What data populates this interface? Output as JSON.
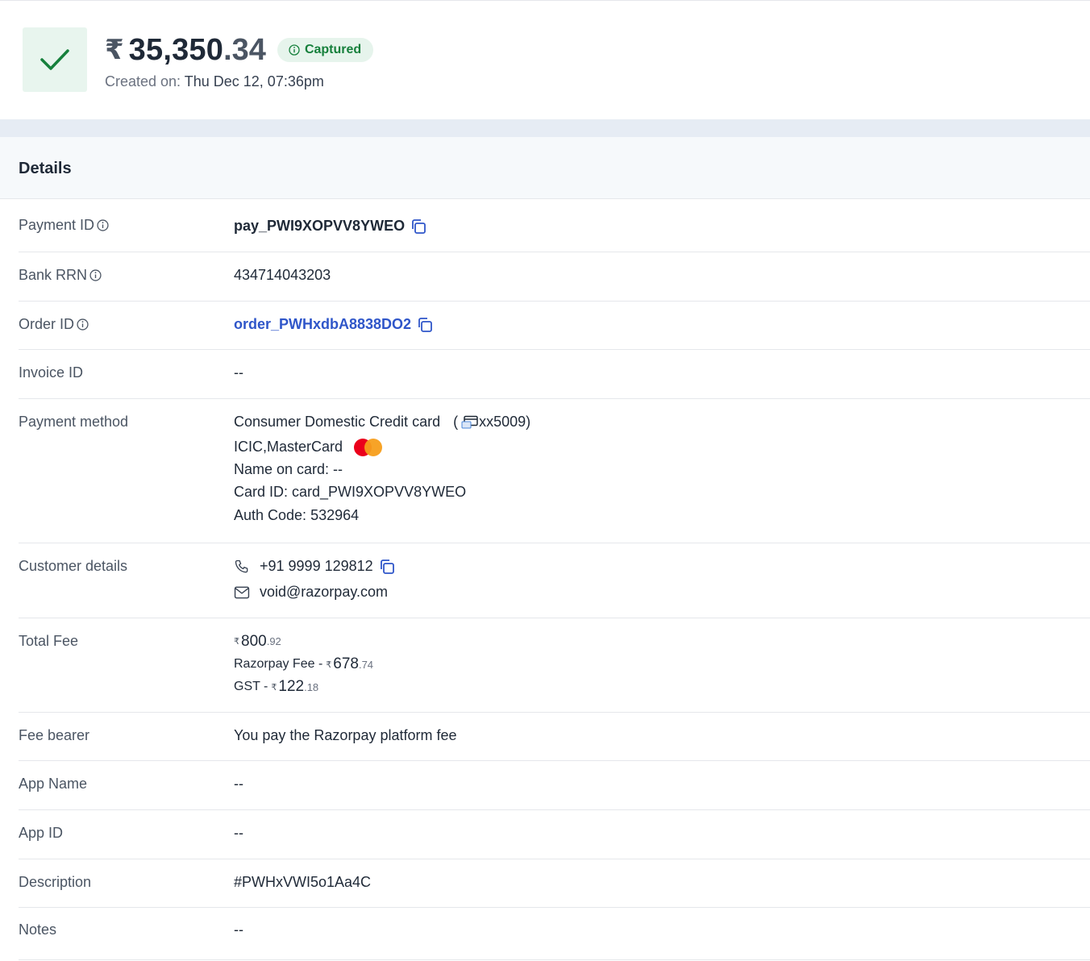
{
  "header": {
    "currency_symbol": "₹",
    "amount_int": "35,350",
    "amount_dec": ".34",
    "status": "Captured",
    "created_label": "Created on:",
    "created_value": "Thu Dec 12, 07:36pm"
  },
  "section": {
    "title": "Details"
  },
  "rows": {
    "payment_id": {
      "label": "Payment ID",
      "value": "pay_PWI9XOPVV8YWEO"
    },
    "bank_rrn": {
      "label": "Bank RRN",
      "value": "434714043203"
    },
    "order_id": {
      "label": "Order ID",
      "value": "order_PWHxdbA8838DO2"
    },
    "invoice_id": {
      "label": "Invoice ID",
      "value": "--"
    },
    "payment_method": {
      "label": "Payment method",
      "type": "Consumer Domestic Credit card",
      "card_open": "(",
      "card_last": "xx5009)",
      "network": "ICIC,MasterCard",
      "name_on_card": "Name on card: --",
      "card_id": "Card ID: card_PWI9XOPVV8YWEO",
      "auth_code": "Auth Code: 532964"
    },
    "customer": {
      "label": "Customer details",
      "phone": "+91 9999 129812",
      "email": "void@razorpay.com"
    },
    "total_fee": {
      "label": "Total Fee",
      "currency": "₹",
      "total_int": "800",
      "total_dec": ".92",
      "razorpay_label": "Razorpay Fee - ",
      "razorpay_int": "678",
      "razorpay_dec": ".74",
      "gst_label": "GST - ",
      "gst_int": "122",
      "gst_dec": ".18"
    },
    "fee_bearer": {
      "label": "Fee bearer",
      "value": "You pay the Razorpay platform fee"
    },
    "app_name": {
      "label": "App Name",
      "value": "--"
    },
    "app_id": {
      "label": "App ID",
      "value": "--"
    },
    "description": {
      "label": "Description",
      "value": "#PWHxVWI5o1Aa4C"
    },
    "notes": {
      "label": "Notes",
      "value": "--"
    }
  },
  "colors": {
    "success": "#16803c",
    "success_bg": "#e6f4ec",
    "link": "#2f56c9",
    "band": "#e6ecf4"
  }
}
